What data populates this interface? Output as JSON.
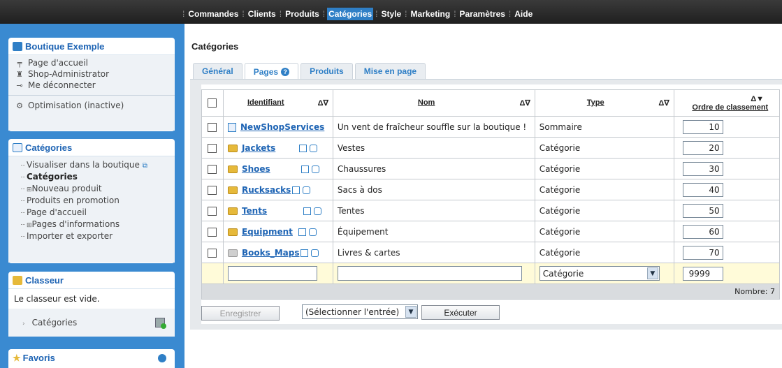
{
  "topnav": [
    "Commandes",
    "Clients",
    "Produits",
    "Catégories",
    "Style",
    "Marketing",
    "Paramètres",
    "Aide"
  ],
  "topnav_active": 3,
  "sidebar": {
    "shop": {
      "title": "Boutique Exemple",
      "items": [
        "Page d'accueil",
        "Shop-Administrator",
        "Me déconnecter"
      ],
      "optim": "Optimisation (inactive)"
    },
    "categories": {
      "title": "Catégories",
      "items": [
        "Visualiser dans la boutique",
        "Catégories",
        "Nouveau produit",
        "Produits en promotion",
        "Page d'accueil",
        "Pages d'informations",
        "Importer et exporter"
      ]
    },
    "classeur": {
      "title": "Classeur",
      "empty": "Le classeur est vide.",
      "item": "Catégories"
    },
    "favoris": {
      "title": "Favoris"
    }
  },
  "page_title": "Catégories",
  "tabs": [
    "Général",
    "Pages",
    "Produits",
    "Mise en page"
  ],
  "tab_help": "?",
  "table": {
    "headers": {
      "ident": "Identifiant",
      "nom": "Nom",
      "type": "Type",
      "ordre": "Ordre de classement"
    },
    "sort_icon": "Δ∇",
    "sort_icon_active": "Δ▼",
    "rows": [
      {
        "ident": "NewShopServices",
        "nom": "Un vent de fraîcheur souffle sur la boutique !",
        "type": "Sommaire",
        "ordre": "10"
      },
      {
        "ident": "Jackets",
        "nom": "Vestes",
        "type": "Catégorie",
        "ordre": "20"
      },
      {
        "ident": "Shoes",
        "nom": "Chaussures",
        "type": "Catégorie",
        "ordre": "30"
      },
      {
        "ident": "Rucksacks",
        "nom": "Sacs à dos",
        "type": "Catégorie",
        "ordre": "40"
      },
      {
        "ident": "Tents",
        "nom": "Tentes",
        "type": "Catégorie",
        "ordre": "50"
      },
      {
        "ident": "Equipment",
        "nom": "Équipement",
        "type": "Catégorie",
        "ordre": "60"
      },
      {
        "ident": "Books_Maps",
        "nom": "Livres & cartes",
        "type": "Catégorie",
        "ordre": "70"
      }
    ],
    "new_row": {
      "type": "Catégorie",
      "ordre": "9999"
    },
    "count": "Nombre: 7"
  },
  "actions": {
    "save": "Enregistrer",
    "select": "(Sélectionner l'entrée)",
    "execute": "Exécuter"
  }
}
